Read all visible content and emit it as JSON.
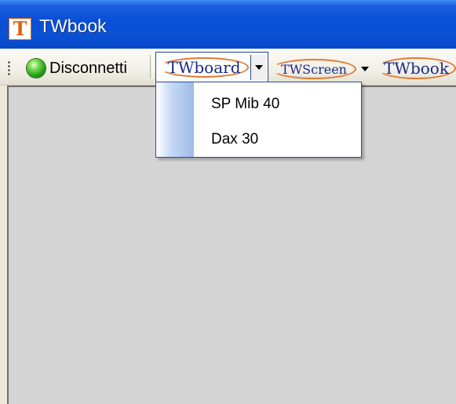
{
  "window": {
    "title": "TWbook",
    "icon_letter": "T"
  },
  "toolbar": {
    "connect_label": "Disconnetti",
    "status_led": "green-status-icon",
    "twboard_logo": "TWboard",
    "twscreen_logo": "TWScreen",
    "twbook_logo": "TWbook"
  },
  "dropdown_menu": {
    "items": [
      {
        "label": "SP Mib 40"
      },
      {
        "label": "Dax 30"
      }
    ]
  },
  "colors": {
    "titlebar": "#0a4fd6",
    "menu_border": "#2c4e92",
    "content_bg": "#d4d4d4",
    "logo_swoosh": "#e07a30",
    "logo_text": "#1a2a8a"
  }
}
